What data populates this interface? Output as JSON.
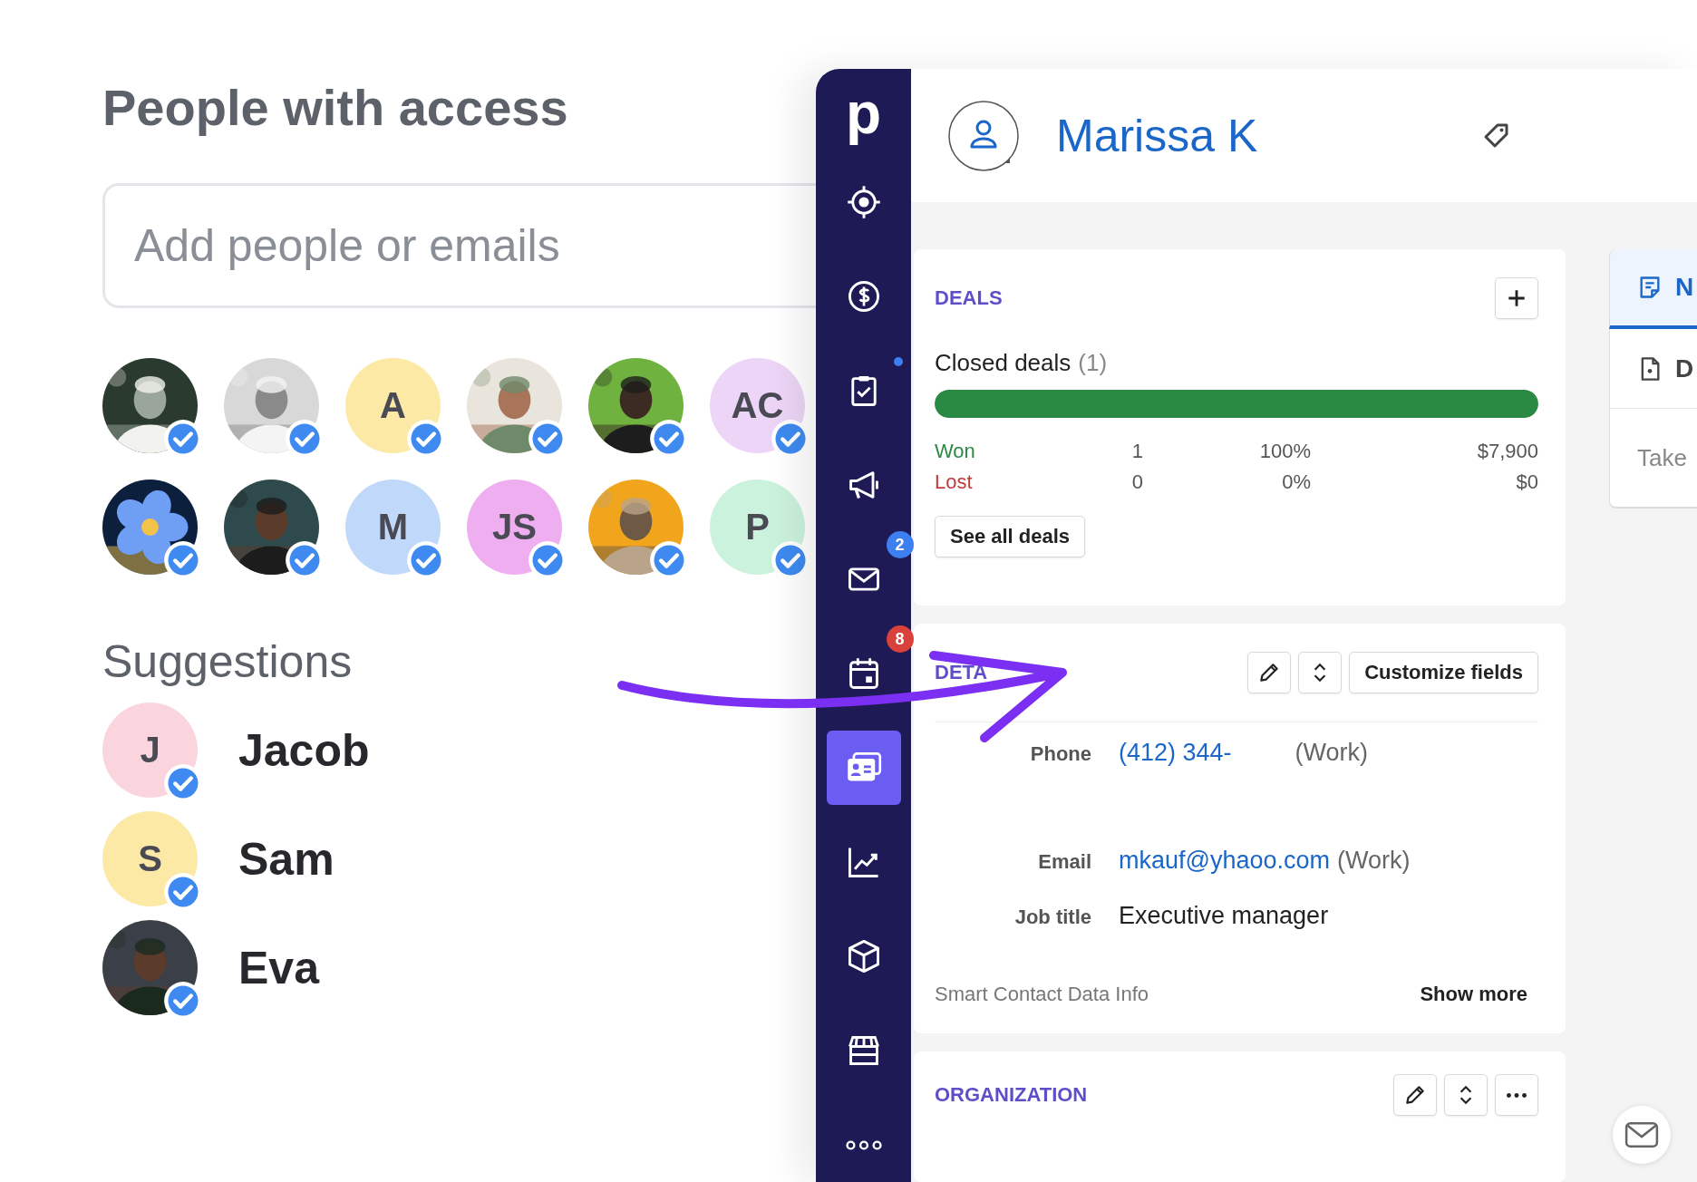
{
  "people_panel": {
    "title": "People with access",
    "search": {
      "placeholder": "Add people or emails"
    },
    "people": [
      {
        "kind": "picture"
      },
      {
        "kind": "picture"
      },
      {
        "kind": "initials",
        "initials": "A",
        "color": "#fde9a6"
      },
      {
        "kind": "picture"
      },
      {
        "kind": "picture"
      },
      {
        "kind": "initials",
        "initials": "AC",
        "color": "#ecd5f6"
      },
      {
        "kind": "picture"
      },
      {
        "kind": "picture"
      },
      {
        "kind": "initials",
        "initials": "M",
        "color": "#c0d9fb"
      },
      {
        "kind": "initials",
        "initials": "JS",
        "color": "#eeaef0"
      },
      {
        "kind": "picture"
      },
      {
        "kind": "initials",
        "initials": "P",
        "color": "#cbf2dc"
      }
    ],
    "suggestions_title": "Suggestions",
    "suggestions": [
      {
        "name": "Jacob",
        "avatar": {
          "kind": "initials",
          "initials": "J",
          "color": "#fbd5de"
        }
      },
      {
        "name": "Sam",
        "avatar": {
          "kind": "initials",
          "initials": "S",
          "color": "#fde9a6"
        }
      },
      {
        "name": "Eva",
        "avatar": {
          "kind": "picture"
        }
      }
    ]
  },
  "app": {
    "logo": "p",
    "nav": [
      {
        "selected": false
      },
      {
        "selected": false
      },
      {
        "selected": false,
        "badge": {
          "kind": "dot",
          "color": "#3d7ef0"
        }
      },
      {
        "selected": false
      },
      {
        "selected": false,
        "badge": {
          "kind": "count",
          "text": "2",
          "color": "#3d7ef0"
        }
      },
      {
        "selected": false,
        "badge": {
          "kind": "count",
          "text": "8",
          "color": "#d9423a"
        }
      },
      {
        "selected": true
      },
      {
        "selected": false
      },
      {
        "selected": false
      },
      {
        "selected": false
      },
      {
        "selected": false
      }
    ],
    "contact": {
      "name": "Marissa K"
    },
    "deals": {
      "title": "DEALS",
      "closed_label": "Closed deals",
      "closed_count": "(1)",
      "level": 1.0,
      "rows": [
        {
          "kind": "won",
          "label": "Won",
          "count": "1",
          "percent": "100%",
          "amount": "$7,900"
        },
        {
          "kind": "lost",
          "label": "Lost",
          "count": "0",
          "percent": "0%",
          "amount": "$0"
        }
      ],
      "button": "See all deals"
    },
    "details": {
      "title": "DETA",
      "customize": "Customize fields",
      "fields": [
        {
          "label": "Phone",
          "kind": "link",
          "value": "(412) 344-",
          "note": "(Work)"
        },
        {
          "label": "Email",
          "kind": "link",
          "value": "mkauf@yhaoo.com",
          "note": "(Work)"
        },
        {
          "label": "Job title",
          "kind": "text",
          "value": "Executive manager"
        }
      ],
      "smart_info": "Smart Contact Data Info",
      "show_more": "Show more"
    },
    "organization": {
      "title": "ORGANIZATION"
    },
    "side_tabs": [
      {
        "label": "N",
        "selected": true
      },
      {
        "label": "D",
        "selected": false
      }
    ],
    "note_placeholder": "Take"
  }
}
